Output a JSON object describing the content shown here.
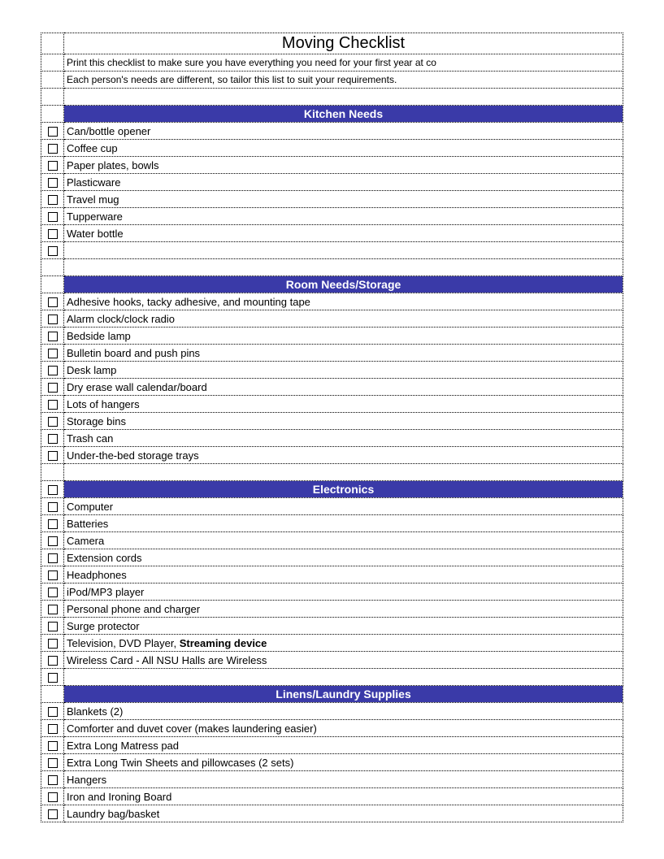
{
  "title": "Moving Checklist",
  "intro_lines": [
    "Print this checklist to make sure you have everything you need for your first year at co",
    "Each person's needs are different, so tailor this list to suit your requirements."
  ],
  "sections": [
    {
      "header": "Kitchen Needs",
      "check_in_spacer_before": false,
      "items": [
        {
          "text": "Can/bottle opener"
        },
        {
          "text": "Coffee cup"
        },
        {
          "text": "Paper plates, bowls"
        },
        {
          "text": "Plasticware"
        },
        {
          "text": "Travel mug"
        },
        {
          "text": "Tupperware"
        },
        {
          "text": "Water bottle"
        },
        {
          "text": ""
        }
      ]
    },
    {
      "header": "Room Needs/Storage",
      "check_in_spacer_before": false,
      "items": [
        {
          "text": "Adhesive hooks, tacky adhesive, and mounting tape"
        },
        {
          "text": "Alarm clock/clock radio"
        },
        {
          "text": "Bedside lamp"
        },
        {
          "text": "Bulletin board and push pins"
        },
        {
          "text": "Desk lamp"
        },
        {
          "text": "Dry erase wall calendar/board"
        },
        {
          "text": "Lots of hangers"
        },
        {
          "text": "Storage bins"
        },
        {
          "text": "Trash can"
        },
        {
          "text": "Under-the-bed storage trays"
        }
      ]
    },
    {
      "header": "Electronics",
      "check_in_spacer_before": true,
      "items": [
        {
          "text": "Computer"
        },
        {
          "text": "Batteries"
        },
        {
          "text": "Camera"
        },
        {
          "text": "Extension cords"
        },
        {
          "text": "Headphones"
        },
        {
          "text": "iPod/MP3 player"
        },
        {
          "text": "Personal phone and charger"
        },
        {
          "text": "Surge protector"
        },
        {
          "text": "Television, DVD Player, ",
          "bold_suffix": "Streaming device"
        },
        {
          "text": "Wireless Card - All NSU Halls are Wireless"
        },
        {
          "text": ""
        }
      ],
      "no_spacer_after": true
    },
    {
      "header": "Linens/Laundry Supplies",
      "check_in_spacer_before": false,
      "items": [
        {
          "text": "Blankets (2)"
        },
        {
          "text": "Comforter and duvet cover (makes laundering easier)"
        },
        {
          "text": "Extra Long Matress pad"
        },
        {
          "text": "Extra Long Twin Sheets and pillowcases (2 sets)"
        },
        {
          "text": "Hangers"
        },
        {
          "text": "Iron and Ironing Board"
        },
        {
          "text": "Laundry bag/basket"
        }
      ]
    }
  ]
}
